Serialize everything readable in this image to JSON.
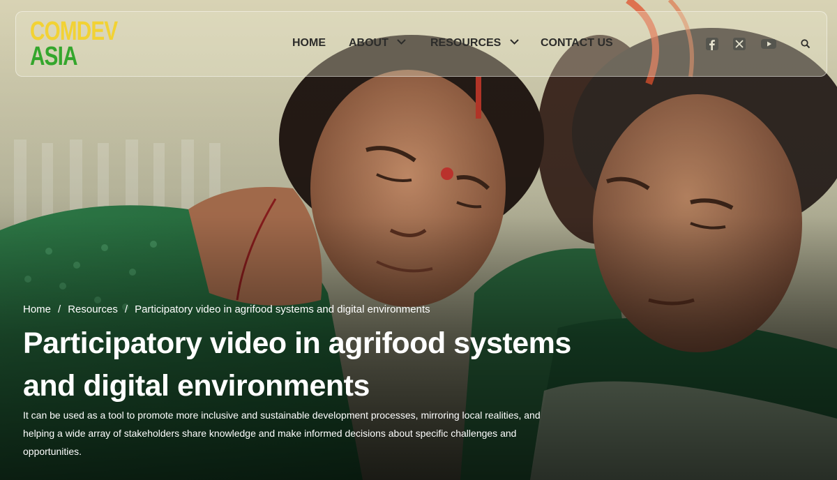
{
  "logo": {
    "line1": "COMDEV",
    "line2": "ASIA",
    "line1_color": "#f2d234",
    "line2_color": "#34a62c"
  },
  "nav": {
    "items": [
      {
        "label": "HOME",
        "has_dropdown": false
      },
      {
        "label": "ABOUT",
        "has_dropdown": true
      },
      {
        "label": "RESOURCES",
        "has_dropdown": true
      },
      {
        "label": "CONTACT US",
        "has_dropdown": false
      }
    ]
  },
  "social": {
    "icons": [
      "facebook-icon",
      "x-twitter-icon",
      "youtube-icon"
    ]
  },
  "search": {
    "icon": "search-icon"
  },
  "breadcrumb": {
    "items": [
      "Home",
      "Resources",
      "Participatory video in agrifood systems and digital environments"
    ],
    "separator": "/"
  },
  "hero": {
    "title": "Participatory video in agrifood systems and digital environments",
    "description": "It can be used as a tool to promote more inclusive and sustainable development processes, mirroring local realities, and helping a wide array of stakeholders share knowledge and make informed decisions about specific challenges and opportunities."
  }
}
